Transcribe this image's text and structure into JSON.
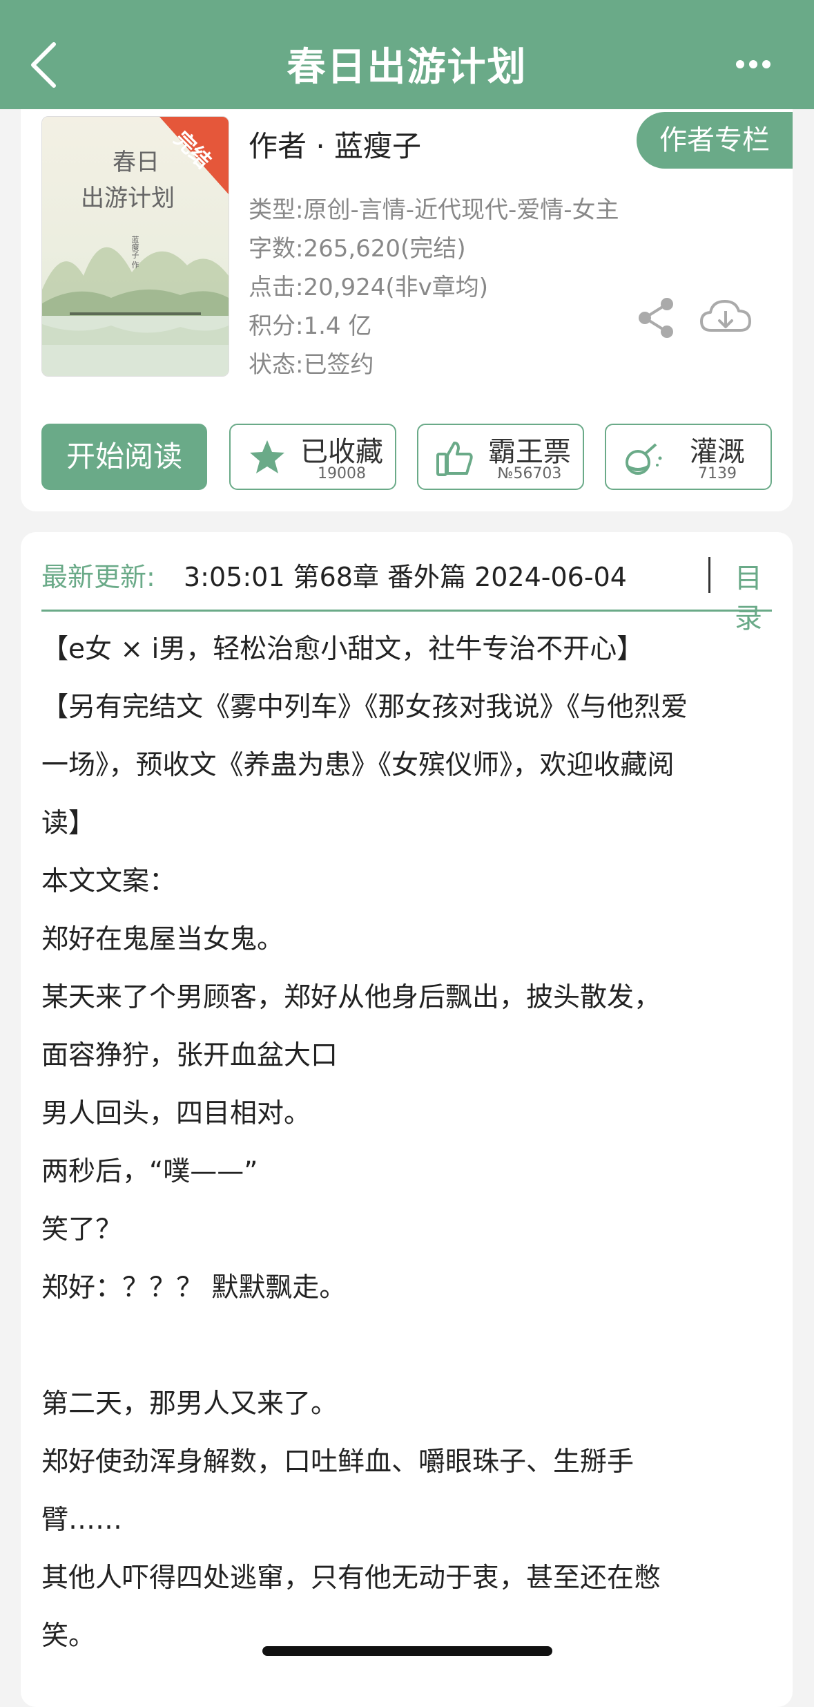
{
  "header": {
    "title": "春日出游计划"
  },
  "book": {
    "cover": {
      "title_line1": "春日",
      "title_line2": "出游计划",
      "ribbon": "完结",
      "author_tag": "蓝瘦子 作"
    },
    "author_line": "作者 · 蓝瘦子",
    "author_column_button": "作者专栏",
    "meta": {
      "type": "类型:原创-言情-近代现代-爱情-女主",
      "words": "字数:265,620(完结)",
      "clicks": "点击:20,924(非v章均)",
      "score": "积分:1.4 亿",
      "status": "状态:已签约"
    }
  },
  "actions": {
    "start_reading": "开始阅读",
    "favorite": {
      "label": "已收藏",
      "count": "19008"
    },
    "ticket": {
      "label": "霸王票",
      "count": "№56703"
    },
    "nutrient": {
      "label": "灌溉",
      "count": "7139"
    }
  },
  "update": {
    "label": "最新更新:",
    "info": "3:05:01  第68章 番外篇 2024-06-04",
    "toc": "目录"
  },
  "intro": [
    "【e女 × i男，轻松治愈小甜文，社牛专治不开心】",
    "【另有完结文《雾中列车》《那女孩对我说》《与他烈爱",
    "一场》，预收文《养蛊为患》《女殡仪师》，欢迎收藏阅",
    "读】",
    "本文文案：",
    "郑好在鬼屋当女鬼。",
    "某天来了个男顾客，郑好从他身后飘出，披头散发，",
    "面容狰狞，张开血盆大口",
    "男人回头，四目相对。",
    "两秒后，“噗——”",
    "笑了？",
    "郑好：？？？ 默默飘走。",
    "",
    "第二天，那男人又来了。",
    "郑好使劲浑身解数，口吐鲜血、嚼眼珠子、生掰手",
    "臂……",
    "其他人吓得四处逃窜，只有他无动于衷，甚至还在憋",
    "笑。"
  ],
  "colors": {
    "accent": "#6aaa88"
  }
}
